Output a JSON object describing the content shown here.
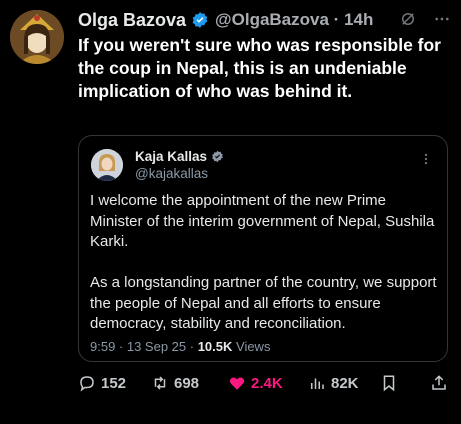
{
  "author": {
    "name": "Olga Bazova",
    "handle_time": "@OlgaBazova · 14h",
    "icons": {
      "verified": "verified-badge-icon",
      "grok": "grok-icon",
      "more": "more-icon"
    }
  },
  "tweet": {
    "text": "If you weren't sure who was responsible for the coup in Nepal, this is an undeniable implication of who was behind it."
  },
  "quote": {
    "name": "Kaja Kallas",
    "handle": "@kajakallas",
    "paragraph1": "I welcome the appointment of the new Prime Minister of the interim government of Nepal, Sushila Karki.",
    "paragraph2": "As a longstanding  partner of the country, we support the people of Nepal and all efforts to ensure democracy, stability and reconciliation.",
    "time": "9:59 · 13 Sep 25 · ",
    "views_count": "10.5K",
    "views_label": " Views"
  },
  "actions": {
    "replies": "152",
    "reposts": "698",
    "likes": "2.4K",
    "views": "82K"
  },
  "colors": {
    "like": "#f91880",
    "verified": "#1d9bf0",
    "background": "#000000"
  }
}
